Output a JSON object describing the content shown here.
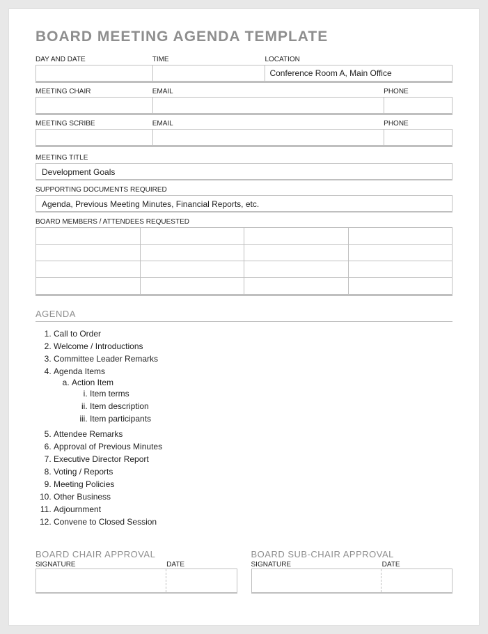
{
  "title": "BOARD MEETING AGENDA TEMPLATE",
  "row1": {
    "day_date_label": "DAY AND DATE",
    "day_date_value": "",
    "time_label": "TIME",
    "time_value": "",
    "location_label": "LOCATION",
    "location_value": "Conference Room A, Main Office"
  },
  "chair": {
    "label": "MEETING CHAIR",
    "value": "",
    "email_label": "EMAIL",
    "email_value": "",
    "phone_label": "PHONE",
    "phone_value": ""
  },
  "scribe": {
    "label": "MEETING SCRIBE",
    "value": "",
    "email_label": "EMAIL",
    "email_value": "",
    "phone_label": "PHONE",
    "phone_value": ""
  },
  "meeting_title": {
    "label": "MEETING TITLE",
    "value": "Development Goals"
  },
  "supporting_docs": {
    "label": "SUPPORTING DOCUMENTS REQUIRED",
    "value": "Agenda, Previous Meeting Minutes, Financial Reports, etc."
  },
  "attendees": {
    "label": "BOARD MEMBERS / ATTENDEES REQUESTED"
  },
  "agenda_heading": "AGENDA",
  "agenda": {
    "i1": "Call to Order",
    "i2": "Welcome / Introductions",
    "i3": "Committee Leader Remarks",
    "i4": "Agenda Items",
    "i4a": "Action Item",
    "i4a1": "Item terms",
    "i4a2": "Item description",
    "i4a3": "Item participants",
    "i5": "Attendee Remarks",
    "i6": "Approval of Previous Minutes",
    "i7": "Executive Director Report",
    "i8": "Voting / Reports",
    "i9": "Meeting Policies",
    "i10": "Other Business",
    "i11": "Adjournment",
    "i12": "Convene to Closed Session"
  },
  "approval": {
    "chair_heading": "BOARD CHAIR APPROVAL",
    "subchair_heading": "BOARD SUB-CHAIR APPROVAL",
    "signature_label": "SIGNATURE",
    "date_label": "DATE"
  }
}
